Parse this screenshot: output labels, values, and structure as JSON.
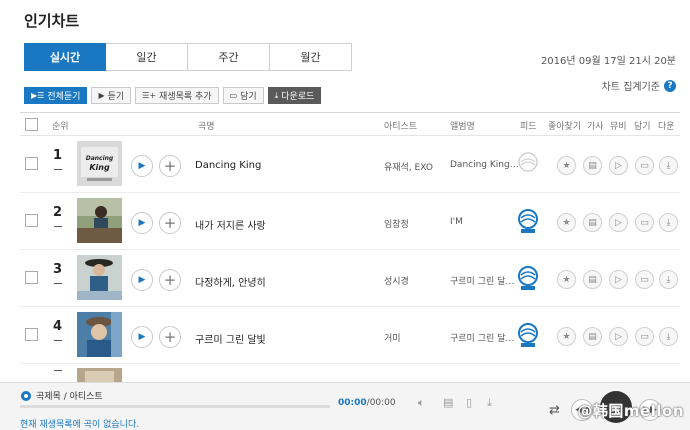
{
  "page_title": "인기차트",
  "tabs": [
    {
      "label": "실시간",
      "active": true
    },
    {
      "label": "일간",
      "active": false
    },
    {
      "label": "주간",
      "active": false
    },
    {
      "label": "월간",
      "active": false
    }
  ],
  "timestamp": "2016년 09월 17일 21시 20분",
  "criteria_label": "차트 집계기준",
  "toolbar": {
    "play_all": "전체듣기",
    "listen": "듣기",
    "add_playlist": "재생목록 추가",
    "save": "담기",
    "download": "다운로드"
  },
  "columns": {
    "rank": "순위",
    "song": "곡명",
    "artist": "아티스트",
    "album": "앨범명",
    "feed": "피드",
    "favorite": "좋아찾기",
    "lyrics": "가사",
    "mv": "뮤비",
    "save": "담기",
    "download": "다운"
  },
  "rows": [
    {
      "rank": "1",
      "song": "Dancing King",
      "artist": "유재석, EXO",
      "album": "Dancing King…",
      "feed_active": false,
      "thumb_text": "Dancing King"
    },
    {
      "rank": "2",
      "song": "내가 저지른 사랑",
      "artist": "임창정",
      "album": "I'M",
      "feed_active": true,
      "thumb_text": ""
    },
    {
      "rank": "3",
      "song": "다정하게, 안녕히",
      "artist": "성시경",
      "album": "구르미 그린 달…",
      "feed_active": true,
      "thumb_text": ""
    },
    {
      "rank": "4",
      "song": "구르미 그린 달빛",
      "artist": "거미",
      "album": "구르미 그린 달…",
      "feed_active": true,
      "thumb_text": ""
    }
  ],
  "player": {
    "now_playing": "곡제목 / 아티스트",
    "current_time": "00:00",
    "total_time": "/00:00",
    "empty_notice": "현재 재생목록에 곡이 없습니다."
  },
  "watermark": "@韩国mellon",
  "colors": {
    "accent": "#1a78c2",
    "download_btn": "#5a5a5a"
  }
}
